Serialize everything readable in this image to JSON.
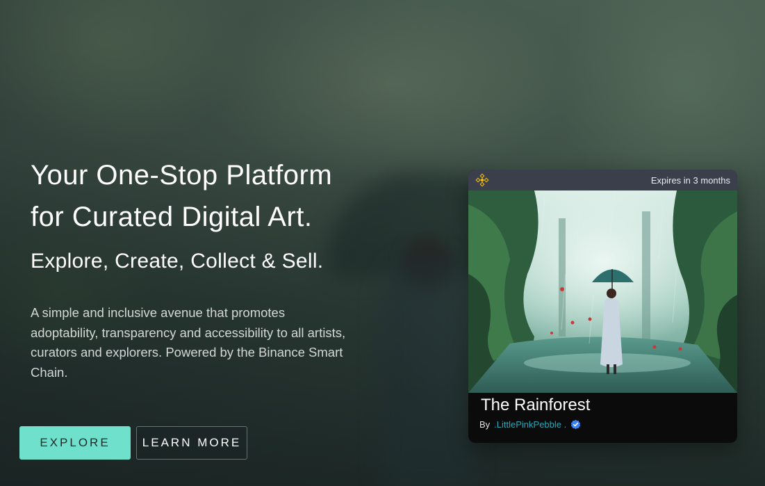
{
  "hero": {
    "headline_line1": "Your One-Stop Platform",
    "headline_line2": "for Curated Digital Art.",
    "subheadline": "Explore, Create, Collect & Sell.",
    "description": "A simple and inclusive avenue that promotes adoptability, transparency and accessibility to all artists, curators and explorers. Powered by the Binance Smart Chain."
  },
  "buttons": {
    "explore": "EXPLORE",
    "learn_more": "LEARN MORE"
  },
  "card": {
    "chain_icon": "binance-icon",
    "expires": "Expires in 3 months",
    "title": "The Rainforest",
    "by_label": "By",
    "artist": ".LittlePinkPebble .",
    "verified_icon": "verified-badge-icon"
  },
  "colors": {
    "accent": "#6ee0cb",
    "artist_link": "#2aa7b8",
    "binance_yellow": "#f0b90b",
    "verified_blue": "#3b82f6"
  }
}
